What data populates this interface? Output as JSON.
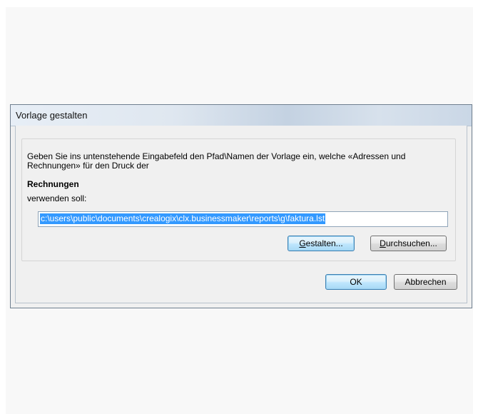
{
  "dialog": {
    "title": "Vorlage gestalten",
    "description": "Geben Sie ins untenstehende Eingabefeld den Pfad\\Namen der Vorlage ein, welche «Adressen und Rechnungen» für den Druck der",
    "heading": "Rechnungen",
    "use_label": "verwenden soll:",
    "path_value": "c:\\users\\public\\documents\\crealogix\\clx.businessmaker\\reports\\g\\faktura.lst",
    "buttons": {
      "design_accel": "G",
      "design_rest": "estalten...",
      "browse_accel": "D",
      "browse_rest": "urchsuchen...",
      "ok": "OK",
      "cancel": "Abbrechen"
    }
  }
}
